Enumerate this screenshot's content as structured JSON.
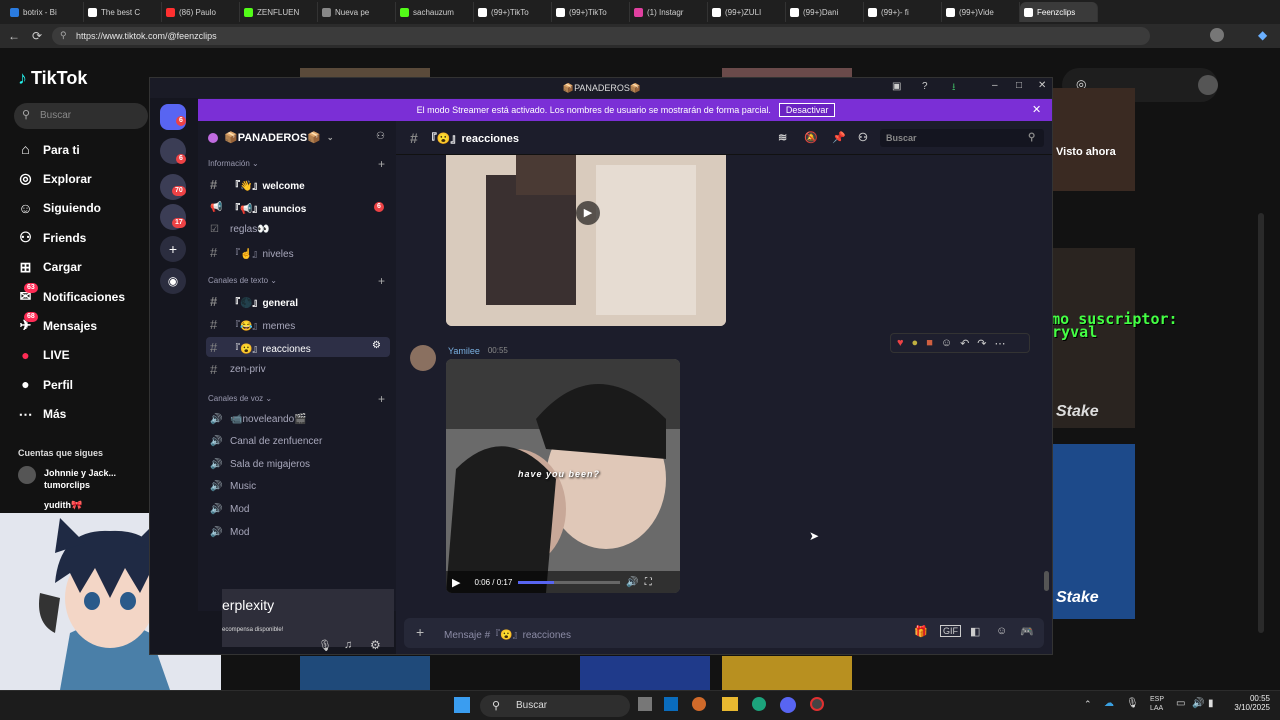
{
  "browser": {
    "tabs": [
      "botrix - Bi",
      "The best C",
      "(86) Paulo",
      "ZENFLUEN",
      "Nueva pe",
      "sachauzum",
      "(99+)TikTo",
      "(99+)TikTo",
      "(1) Instagr",
      "(99+)ZULI",
      "(99+)Dani",
      "(99+)- fi",
      "(99+)Vide",
      "Feenzclips"
    ],
    "url": "https://www.tiktok.com/@feenzclips"
  },
  "tiktok": {
    "logo": "TikTok",
    "search_placeholder": "Buscar",
    "nav": [
      {
        "label": "Para ti",
        "icon": "home-icon"
      },
      {
        "label": "Explorar",
        "icon": "compass-icon"
      },
      {
        "label": "Siguiendo",
        "icon": "user-follow-icon"
      },
      {
        "label": "Friends",
        "icon": "friends-icon"
      },
      {
        "label": "Cargar",
        "icon": "upload-icon"
      },
      {
        "label": "Notificaciones",
        "icon": "bell-icon",
        "badge": "63"
      },
      {
        "label": "Mensajes",
        "icon": "message-icon",
        "badge": "68"
      },
      {
        "label": "LIVE",
        "icon": "live-icon"
      },
      {
        "label": "Perfil",
        "icon": "profile-icon"
      },
      {
        "label": "Más",
        "icon": "more-icon"
      }
    ],
    "following_title": "Cuentas que sigues",
    "following": [
      "Johnnie y Jack...",
      "tumorclips",
      "yudith🎀"
    ],
    "visto_ahora": "Visto ahora",
    "ultimo": "último suscriptor:",
    "ultimo_name": "Patryval",
    "stake": "Stake",
    "perplexity": "erplexity",
    "perplexity_sub": "ecompensa disponible!"
  },
  "discord": {
    "window_title": "📦PANADEROS📦",
    "streamer_text": "El modo Streamer está activado. Los nombres de usuario se mostrarán de forma parcial.",
    "streamer_button": "Desactivar",
    "server_name": "📦PANADEROS📦",
    "guild_badges": [
      "6",
      "6",
      "70",
      "17"
    ],
    "categories": {
      "info": "Información",
      "text": "Canales de texto",
      "voice": "Canales de voz"
    },
    "channels": [
      {
        "label": "『👋』welcome",
        "type": "text",
        "bold": true
      },
      {
        "label": "『📢』anuncios",
        "type": "announce",
        "bold": true,
        "badge": "6"
      },
      {
        "label": "reglas👀",
        "type": "rules"
      },
      {
        "label": "『☝』niveles",
        "type": "text"
      },
      {
        "label": "『🌑』general",
        "type": "text",
        "bold": true
      },
      {
        "label": "『😂』memes",
        "type": "text"
      },
      {
        "label": "『😮』reacciones",
        "type": "text",
        "selected": true
      },
      {
        "label": "zen-priv",
        "type": "text"
      }
    ],
    "voice_channels": [
      "📹noveleando🎬",
      "Canal de zenfuencer",
      "Sala de migajeros",
      "Music",
      "Mod",
      "Mod"
    ],
    "current_channel": "『😮』reacciones",
    "search_placeholder": "Buscar",
    "message": {
      "author": "Yamilee",
      "time": "00:55",
      "caption": "have you been?",
      "progress": "0:06 / 0:17",
      "progress_fraction": 0.35
    },
    "composer_placeholder": "Mensaje #『😮』reacciones"
  },
  "taskbar": {
    "search": "Buscar",
    "lang": "ESP\nLAA",
    "time": "00:55",
    "date": "3/10/2025"
  }
}
